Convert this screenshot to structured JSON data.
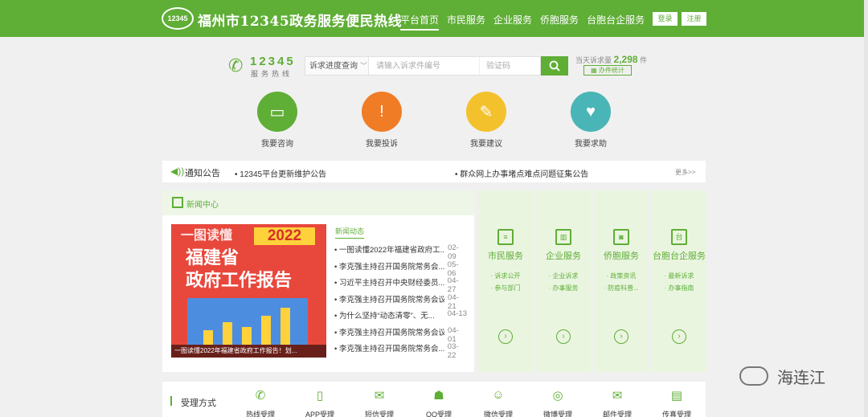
{
  "header": {
    "logo_text": "12345",
    "site_title": "福州市12345政务服务便民热线",
    "nav": [
      "平台首页",
      "市民服务",
      "企业服务",
      "侨胞服务",
      "台胞台企服务"
    ],
    "login": "登录",
    "register": "注册"
  },
  "hotline": {
    "number": "12345",
    "label": "服务热线"
  },
  "search": {
    "type": "诉求进度查询",
    "placeholder": "请输入诉求件编号",
    "code_placeholder": "验证码"
  },
  "today": {
    "prefix": "当天诉求量",
    "count": "2,298",
    "suffix": "件",
    "stats_button": "办件统计"
  },
  "actions": [
    {
      "label": "我要咨询",
      "color": "#5fae36",
      "icon": "chat-icon"
    },
    {
      "label": "我要投诉",
      "color": "#f07d26",
      "icon": "alert-icon"
    },
    {
      "label": "我要建议",
      "color": "#f3c12c",
      "icon": "edit-icon"
    },
    {
      "label": "我要求助",
      "color": "#4ab5b6",
      "icon": "heart-hand-icon"
    }
  ],
  "notice": {
    "title": "通知公告",
    "items": [
      "12345平台更新维护公告",
      "群众网上办事堵点难点问题征集公告"
    ],
    "more": "更多>>"
  },
  "news": {
    "title": "新闻中心",
    "tab": "新闻动态",
    "image": {
      "top": "一图读懂",
      "year": "2022",
      "line1": "福建省",
      "line2": "政府工作报告",
      "caption": "一图读懂2022年福建省政府工作报告！划..."
    },
    "items": [
      {
        "title": "一图读懂2022年福建省政府工...",
        "date": "02-09"
      },
      {
        "title": "李克强主持召开国务院常务会...",
        "date": "05-06"
      },
      {
        "title": "习近平主持召开中央财经委员...",
        "date": "04-27"
      },
      {
        "title": "李克强主持召开国务院常务会议",
        "date": "04-21"
      },
      {
        "title": "为什么坚持“动态清零”、无...",
        "date": "04-13"
      },
      {
        "title": "李克强主持召开国务院常务会议",
        "date": "04-01"
      },
      {
        "title": "李克强主持召开国务院常务会...",
        "date": "03-22"
      }
    ]
  },
  "services": [
    {
      "title": "市民服务",
      "icon": "≡",
      "links": [
        "· 诉求公开",
        "· 参与部门"
      ]
    },
    {
      "title": "企业服务",
      "icon": "▥",
      "links": [
        "· 企业诉求",
        "· 办事服务"
      ]
    },
    {
      "title": "侨胞服务",
      "icon": "◙",
      "links": [
        "· 政策资讯",
        "· 防疫科普..."
      ]
    },
    {
      "title": "台胞台企服务",
      "icon": "台",
      "links": [
        "· 最新诉求",
        "· 办事指南"
      ]
    }
  ],
  "channels": {
    "title": "受理方式",
    "items": [
      {
        "label": "热线受理",
        "icon": "✆"
      },
      {
        "label": "APP受理",
        "icon": "▯"
      },
      {
        "label": "短信受理",
        "icon": "✉"
      },
      {
        "label": "QQ受理",
        "icon": "☗"
      },
      {
        "label": "微信受理",
        "icon": "☺"
      },
      {
        "label": "微博受理",
        "icon": "◎"
      },
      {
        "label": "邮件受理",
        "icon": "✉"
      },
      {
        "label": "传真受理",
        "icon": "▤"
      }
    ]
  },
  "watermark": "海连江"
}
